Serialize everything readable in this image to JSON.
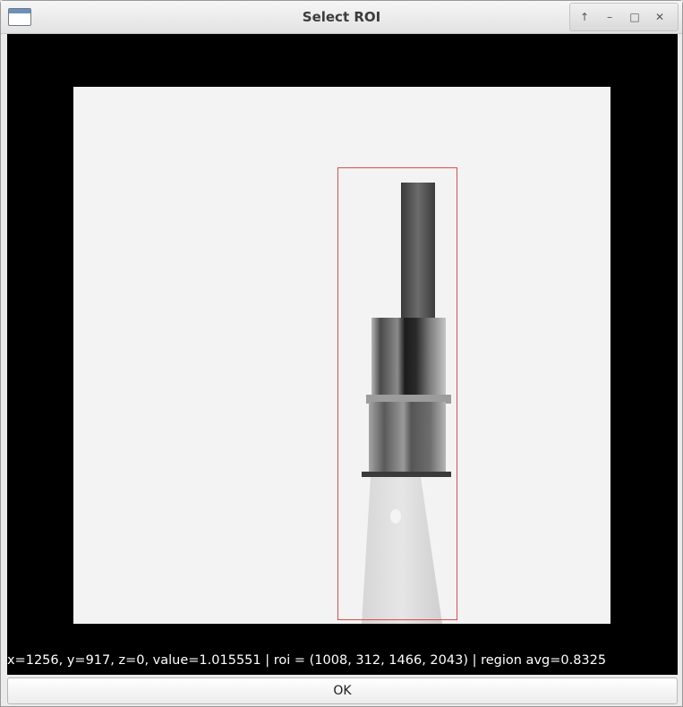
{
  "window": {
    "title": "Select ROI",
    "controls": {
      "up_icon": "↑",
      "minimize_icon": "–",
      "maximize_icon": "□",
      "close_icon": "✕"
    }
  },
  "status": {
    "text": "x=1256, y=917, z=0, value=1.015551 | roi = (1008, 312, 1466, 2043) | region avg=0.8325"
  },
  "ok_button": {
    "label": "OK"
  },
  "colors": {
    "roi_outline": "#e44a4a",
    "canvas_background": "#000000",
    "image_background": "#f3f3f3"
  }
}
